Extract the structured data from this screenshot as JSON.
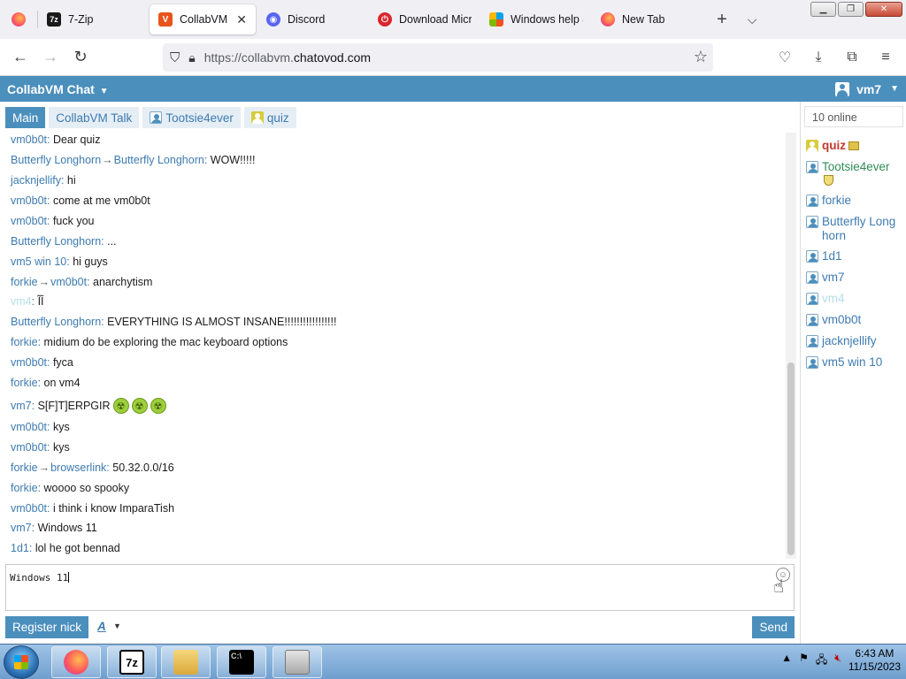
{
  "browser": {
    "tabs": [
      {
        "label": "",
        "icon": "firefox-icon"
      },
      {
        "label": "7-Zip",
        "icon": "7zip-icon"
      },
      {
        "label": "CollabVM Ch",
        "icon": "collabvm-icon",
        "active": true
      },
      {
        "label": "Discord",
        "icon": "discord-icon"
      },
      {
        "label": "Download Micr",
        "icon": "power-icon"
      },
      {
        "label": "Windows help &",
        "icon": "microsoft-icon"
      },
      {
        "label": "New Tab",
        "icon": "firefox-icon"
      }
    ],
    "new_tab_symbol": "+",
    "list_tabs_symbol": "⌵",
    "url_prefix": "https://collabvm.",
    "url_host": "chatovod.com",
    "window_buttons": {
      "minimize": "▁",
      "maximize": "❐",
      "close": "✕"
    }
  },
  "chat": {
    "title": "CollabVM Chat",
    "current_user": "vm7",
    "tabs": [
      {
        "label": "Main",
        "active": true
      },
      {
        "label": "CollabVM Talk"
      },
      {
        "label": "Tootsie4ever",
        "icon": "user-icon"
      },
      {
        "label": "quiz",
        "icon": "user-icon"
      }
    ],
    "messages": [
      {
        "nick": "vm0b0t",
        "text": "Dear quiz"
      },
      {
        "nick": "Butterfly Longhorn",
        "to": "Butterfly Longhorn",
        "text": "WOW!!!!!"
      },
      {
        "nick": "jacknjellify",
        "text": "hi"
      },
      {
        "nick": "vm0b0t",
        "text": "come at me vm0b0t"
      },
      {
        "nick": "vm0b0t",
        "text": "fuck you"
      },
      {
        "nick": "Butterfly Longhorn",
        "text": "..."
      },
      {
        "nick": "vm5 win 10",
        "text": "hi guys"
      },
      {
        "nick": "forkie",
        "to": "vm0b0t",
        "text": "anarchytism"
      },
      {
        "nick": "vm4",
        "text": "ĨĪ",
        "faded": true
      },
      {
        "nick": "Butterfly Longhorn",
        "text": "EVERYTHING IS ALMOST INSANE!!!!!!!!!!!!!!!!!"
      },
      {
        "nick": "forkie",
        "text": "midium do be exploring the mac keyboard options"
      },
      {
        "nick": "vm0b0t",
        "text": "fyca"
      },
      {
        "nick": "forkie",
        "text": "on vm4"
      },
      {
        "nick": "vm7",
        "text": "S[F]T]ERPGIR",
        "emojis": 3
      },
      {
        "nick": "vm0b0t",
        "text": "kys"
      },
      {
        "nick": "vm0b0t",
        "text": "kys"
      },
      {
        "nick": "forkie",
        "to": "browserlink",
        "text": "50.32.0.0/16"
      },
      {
        "nick": "forkie",
        "text": "woooo so spooky"
      },
      {
        "nick": "vm0b0t",
        "text": "i think i know ImparaTish"
      },
      {
        "nick": "vm7",
        "text": "Windows 11"
      },
      {
        "nick": "1d1",
        "text": "lol he got bennad"
      }
    ],
    "message_arrow": "→",
    "input_value": "Windows 11",
    "register_label": "Register nick",
    "font_label": "A",
    "send_label": "Send"
  },
  "sidebar": {
    "online_count": "10 online",
    "users": [
      {
        "name": "quiz",
        "badge": "crown",
        "style": "admin"
      },
      {
        "name": "Tootsie4ever",
        "badge": "shield",
        "style": "mod"
      },
      {
        "name": "forkie"
      },
      {
        "name": "Butterfly Longhorn"
      },
      {
        "name": "1d1"
      },
      {
        "name": "vm7"
      },
      {
        "name": "vm4",
        "style": "faded"
      },
      {
        "name": "vm0b0t"
      },
      {
        "name": "jacknjellify"
      },
      {
        "name": "vm5 win 10"
      }
    ]
  },
  "taskbar": {
    "apps": [
      {
        "name": "firefox",
        "icon": "firefox-icon"
      },
      {
        "name": "7-zip",
        "icon": "7zip-icon",
        "glyph": "7z"
      },
      {
        "name": "explorer",
        "icon": "folder-icon"
      },
      {
        "name": "command-prompt",
        "icon": "cmd-icon",
        "glyph": "C:\\"
      },
      {
        "name": "installer",
        "icon": "installer-icon"
      }
    ],
    "time": "6:43 AM",
    "date": "11/15/2023"
  },
  "colors": {
    "accent": "#4b8fbd",
    "nick": "#3d7bb0",
    "admin": "#c0392b",
    "mod": "#2e8b57"
  }
}
